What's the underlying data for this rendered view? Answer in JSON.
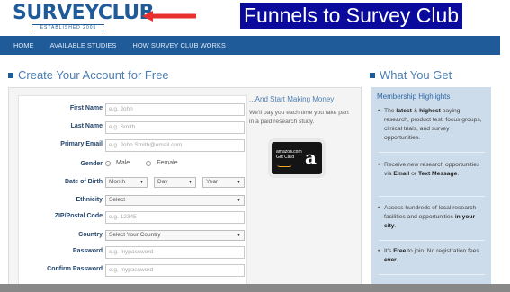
{
  "header": {
    "logo_text": "SURVEYCLUB",
    "logo_tagline": "ESTABLISHED 2005",
    "overlay_title": "Funnels to Survey Club"
  },
  "nav": {
    "items": [
      "HOME",
      "AVAILABLE STUDIES",
      "HOW SURVEY CLUB WORKS"
    ]
  },
  "main": {
    "heading": "Create Your Account for Free",
    "form": {
      "first_name": {
        "label": "First Name",
        "placeholder": "e.g. John"
      },
      "last_name": {
        "label": "Last Name",
        "placeholder": "e.g. Smith"
      },
      "email": {
        "label": "Primary Email",
        "placeholder": "e.g. John.Smith@email.com"
      },
      "gender": {
        "label": "Gender",
        "options": [
          "Male",
          "Female"
        ]
      },
      "dob": {
        "label": "Date of Birth",
        "month": "Month",
        "day": "Day",
        "year": "Year"
      },
      "ethnicity": {
        "label": "Ethnicity",
        "value": "Select"
      },
      "zip": {
        "label": "ZIP/Postal Code",
        "placeholder": "e.g. 12345"
      },
      "country": {
        "label": "Country",
        "value": "Select Your Country"
      },
      "password": {
        "label": "Password",
        "placeholder": "e.g. mypassword"
      },
      "confirm_password": {
        "label": "Confirm Password",
        "placeholder": "e.g. mypassword"
      }
    },
    "promo": {
      "title": "...And Start Making Money",
      "text": "We'll pay you each time you take part in a paid research study.",
      "card_text": "amazon.com Gift Card",
      "card_letter": "a"
    }
  },
  "sidebar": {
    "heading": "What You Get",
    "panel_title": "Membership Highlights",
    "items": [
      {
        "pre": "The ",
        "b1": "latest",
        "mid": " & ",
        "b2": "highest",
        "post": " paying research, product test, focus groups, clinical trials, and survey opportunities."
      },
      {
        "pre": "Receive new research opportunities via ",
        "b1": "Email",
        "mid": " or ",
        "b2": "Text Message",
        "post": "."
      },
      {
        "pre": "Access hundreds of local research facilities and opportunities ",
        "b1": "in your city",
        "mid": "",
        "b2": "",
        "post": "."
      },
      {
        "pre": "It's ",
        "b1": "Free",
        "mid": " to join. No registration fees ",
        "b2": "ever",
        "post": "."
      }
    ]
  },
  "colors": {
    "brand_blue": "#1f5a99",
    "overlay_bg": "#0a0a9c",
    "arrow_red": "#e8302f",
    "sidebar_bg": "#cddceb"
  }
}
